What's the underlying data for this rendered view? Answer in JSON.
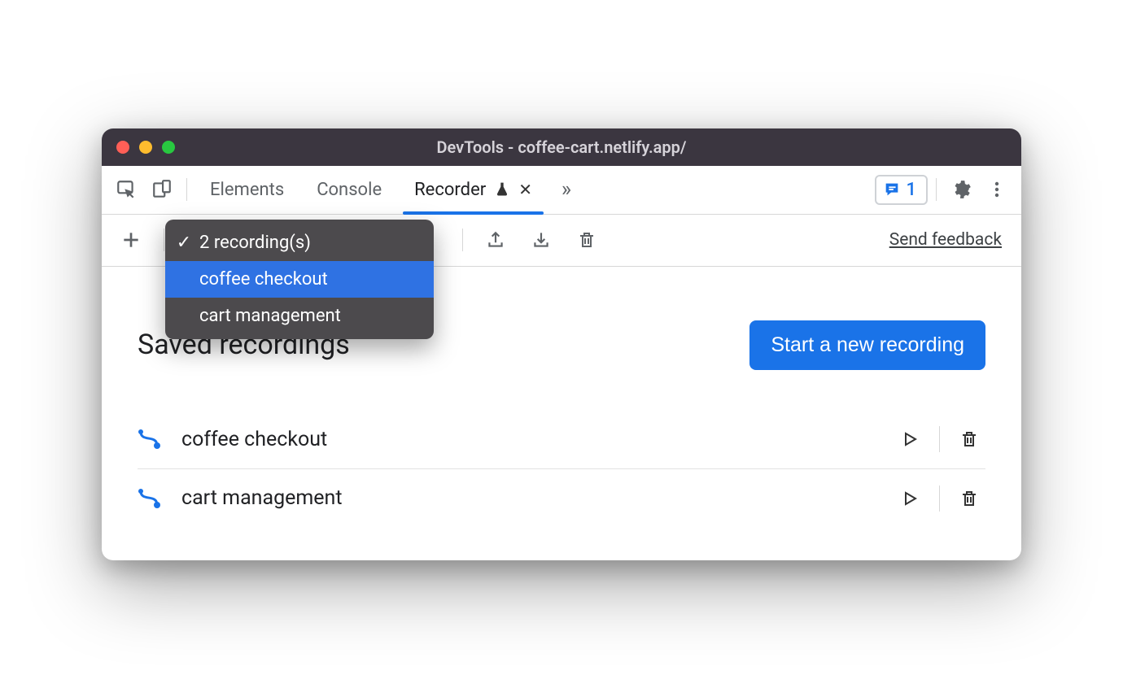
{
  "window": {
    "title": "DevTools - coffee-cart.netlify.app/"
  },
  "tabs": {
    "elements": "Elements",
    "console": "Console",
    "recorder": "Recorder"
  },
  "feedback_badge": {
    "count": "1"
  },
  "toolbar": {
    "send_feedback": "Send feedback"
  },
  "dropdown": {
    "heading": "2 recording(s)",
    "items": [
      "coffee checkout",
      "cart management"
    ]
  },
  "page": {
    "title": "Saved recordings",
    "start_button": "Start a new recording"
  },
  "recordings": [
    {
      "name": "coffee checkout"
    },
    {
      "name": "cart management"
    }
  ]
}
